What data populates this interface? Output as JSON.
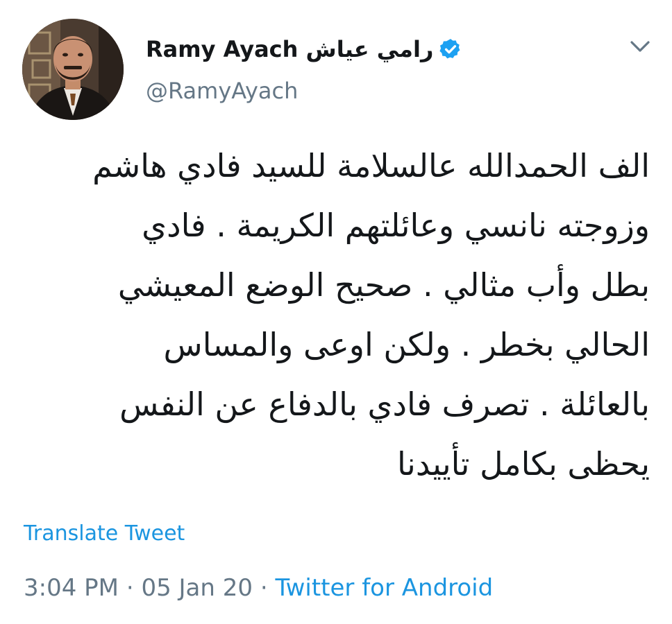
{
  "user": {
    "display_name": "Ramy Ayach رامي عياش",
    "handle": "@RamyAyach",
    "verified": true,
    "avatar_icon": "profile-photo"
  },
  "tweet": {
    "lines": [
      "الف الحمدالله عالسلامة للسيد فادي هاشم",
      "وزوجته نانسي وعائلتهم الكريمة . فادي",
      "بطل وأب مثالي . صحيح الوضع المعيشي",
      "الحالي  بخطر . ولكن اوعى والمساس",
      "بالعائلة . تصرف فادي بالدفاع عن النفس",
      "يحظى بكامل تأييدنا"
    ],
    "translate_label": "Translate Tweet",
    "time": "3:04 PM",
    "separator": "·",
    "date": "05 Jan 20",
    "source": "Twitter for Android"
  },
  "icons": {
    "verified": "verified-badge-icon",
    "menu": "chevron-down-icon"
  },
  "colors": {
    "accent": "#1b95e0",
    "secondary_text": "#657786",
    "primary_text": "#14171a",
    "verified": "#1da1f2"
  }
}
